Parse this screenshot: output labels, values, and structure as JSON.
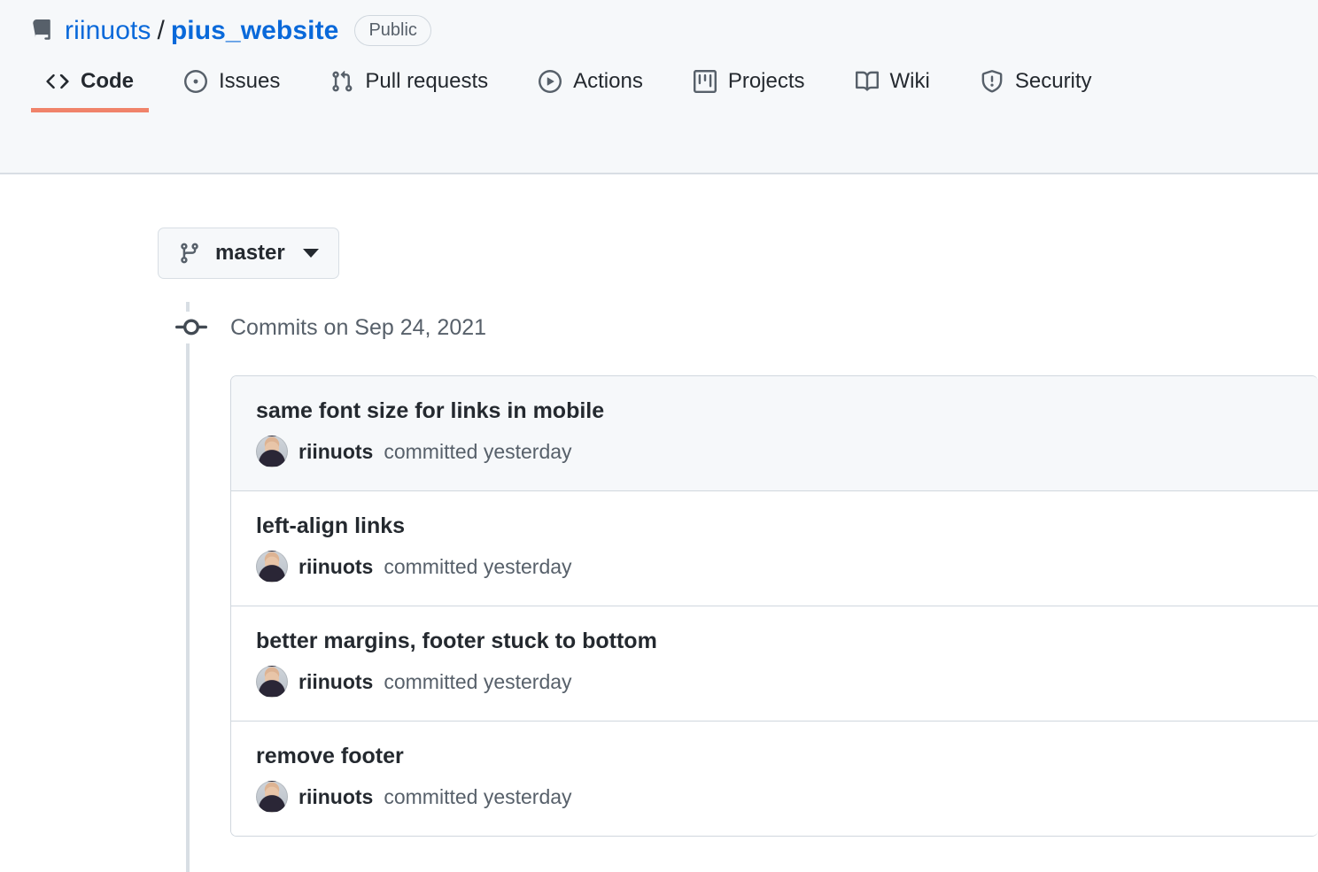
{
  "repo": {
    "icon": "repo-icon",
    "owner": "riinuots",
    "separator": "/",
    "name": "pius_website",
    "visibility": "Public"
  },
  "nav": {
    "tabs": [
      {
        "label": "Code",
        "icon": "code-icon",
        "selected": true
      },
      {
        "label": "Issues",
        "icon": "issue-opened-icon",
        "selected": false
      },
      {
        "label": "Pull requests",
        "icon": "git-pull-request-icon",
        "selected": false
      },
      {
        "label": "Actions",
        "icon": "play-icon",
        "selected": false
      },
      {
        "label": "Projects",
        "icon": "project-icon",
        "selected": false
      },
      {
        "label": "Wiki",
        "icon": "book-icon",
        "selected": false
      },
      {
        "label": "Security",
        "icon": "shield-icon",
        "selected": false
      }
    ],
    "active_underline_color": "#f0836a"
  },
  "branch_selector": {
    "icon": "git-branch-icon",
    "label": "master",
    "caret": "chevron-down-icon"
  },
  "commits": {
    "group_icon": "commit-node-icon",
    "group_title": "Commits on Sep 24, 2021",
    "items": [
      {
        "message": "same font size for links in mobile",
        "author": "riinuots",
        "time": "committed yesterday",
        "highlighted": true
      },
      {
        "message": "left-align links",
        "author": "riinuots",
        "time": "committed yesterday",
        "highlighted": false
      },
      {
        "message": "better margins, footer stuck to bottom",
        "author": "riinuots",
        "time": "committed yesterday",
        "highlighted": false
      },
      {
        "message": "remove footer",
        "author": "riinuots",
        "time": "committed yesterday",
        "highlighted": false
      }
    ]
  },
  "colors": {
    "link": "#0969da",
    "header_bg": "#f6f8fa",
    "border": "#d0d7de",
    "muted_text": "#57606a",
    "text": "#24292f"
  }
}
